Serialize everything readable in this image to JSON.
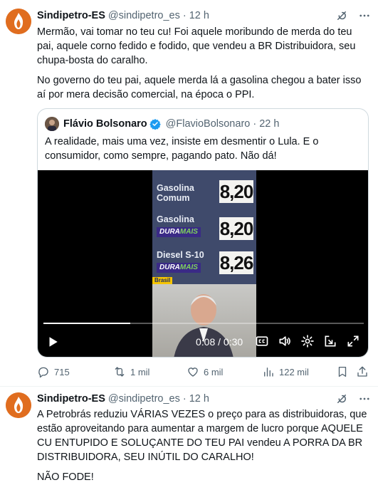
{
  "tweets": [
    {
      "author_name": "Sindipetro-ES",
      "author_handle": "@sindipetro_es",
      "time": "12 h",
      "paragraphs": [
        "Mermão, vai tomar no teu cu! Foi aquele moribundo de merda do teu pai, aquele corno fedido e fodido, que vendeu a BR Distribuidora, seu chupa-bosta do caralho.",
        "No governo do teu pai, aquele merda lá a gasolina chegou a bater isso aí por mera decisão comercial, na época o PPI."
      ],
      "quote": {
        "author_name": "Flávio Bolsonaro",
        "author_handle": "@FlavioBolsonaro",
        "time": "22 h",
        "text": "A realidade, mais uma vez, insiste em desmentir o Lula. E o consumidor, como sempre, pagando pato. Não dá!",
        "video": {
          "labels": {
            "comum_line1": "Gasolina",
            "comum_line2": "Comum",
            "dura_line1": "Gasolina",
            "diesel": "Diesel S-10",
            "dura_badge_a": "DURA",
            "dura_badge_b": "MAIS",
            "brasil_tag": "Brasil"
          },
          "prices": [
            "8,20",
            "8,20",
            "8,26"
          ],
          "timecode": "0:08 / 0:30",
          "progress_fraction": 0.27
        }
      },
      "actions": {
        "replies": "715",
        "reposts": "1 mil",
        "likes": "6 mil",
        "views": "122 mil"
      }
    },
    {
      "author_name": "Sindipetro-ES",
      "author_handle": "@sindipetro_es",
      "time": "12 h",
      "paragraphs": [
        "A Petrobrás reduziu VÁRIAS VEZES o preço para as distribuidoras, que estão aproveitando para aumentar a margem de lucro porque AQUELE CU ENTUPIDO E SOLUÇANTE DO TEU PAI vendeu A PORRA DA BR DISTRIBUIDORA, SEU INÚTIL DO CARALHO!",
        "NÃO FODE!"
      ]
    }
  ],
  "colors": {
    "text_primary": "#0f1419",
    "text_secondary": "#536471",
    "verified_blue": "#1d9bf0",
    "avatar_orange": "#e06d1f"
  },
  "icons": [
    "grok-icon",
    "more-icon",
    "reply-icon",
    "repost-icon",
    "like-icon",
    "views-icon",
    "bookmark-icon",
    "share-icon",
    "verified-icon",
    "play-icon",
    "captions-icon",
    "volume-icon",
    "settings-icon",
    "popout-icon",
    "fullscreen-icon"
  ]
}
